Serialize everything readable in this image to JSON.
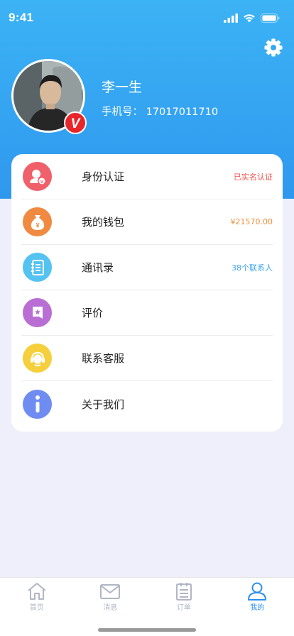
{
  "status_bar": {
    "time": "9:41"
  },
  "profile": {
    "name": "李一生",
    "phone_label": "手机号：",
    "phone": "17017011710",
    "badge_letter": "V"
  },
  "menu": [
    {
      "label": "身份认证",
      "value": "已实名认证",
      "value_color": "#f05252",
      "icon": "id-verify-icon",
      "icon_bg": "#f0606a"
    },
    {
      "label": "我的钱包",
      "value": "¥21570.00",
      "value_color": "#ee8f3c",
      "icon": "wallet-icon",
      "icon_bg": "#f08a42"
    },
    {
      "label": "通讯录",
      "value": "38个联系人",
      "value_color": "#3fa6e8",
      "icon": "contacts-icon",
      "icon_bg": "#54c3f2"
    },
    {
      "label": "评价",
      "value": "",
      "value_color": "",
      "icon": "rating-icon",
      "icon_bg": "#b86ed3"
    },
    {
      "label": "联系客服",
      "value": "",
      "value_color": "",
      "icon": "customer-service-icon",
      "icon_bg": "#f5d03c"
    },
    {
      "label": "关于我们",
      "value": "",
      "value_color": "",
      "icon": "info-icon",
      "icon_bg": "#6e8cf1"
    }
  ],
  "tabs": [
    {
      "label": "首页",
      "icon": "home-icon",
      "active": false
    },
    {
      "label": "消息",
      "icon": "mail-icon",
      "active": false
    },
    {
      "label": "订单",
      "icon": "order-icon",
      "active": false
    },
    {
      "label": "我的",
      "icon": "user-icon",
      "active": true
    }
  ],
  "colors": {
    "header": "#2f98ee",
    "active_tab": "#2b8ff0",
    "inactive_tab": "#b0b6c4"
  }
}
